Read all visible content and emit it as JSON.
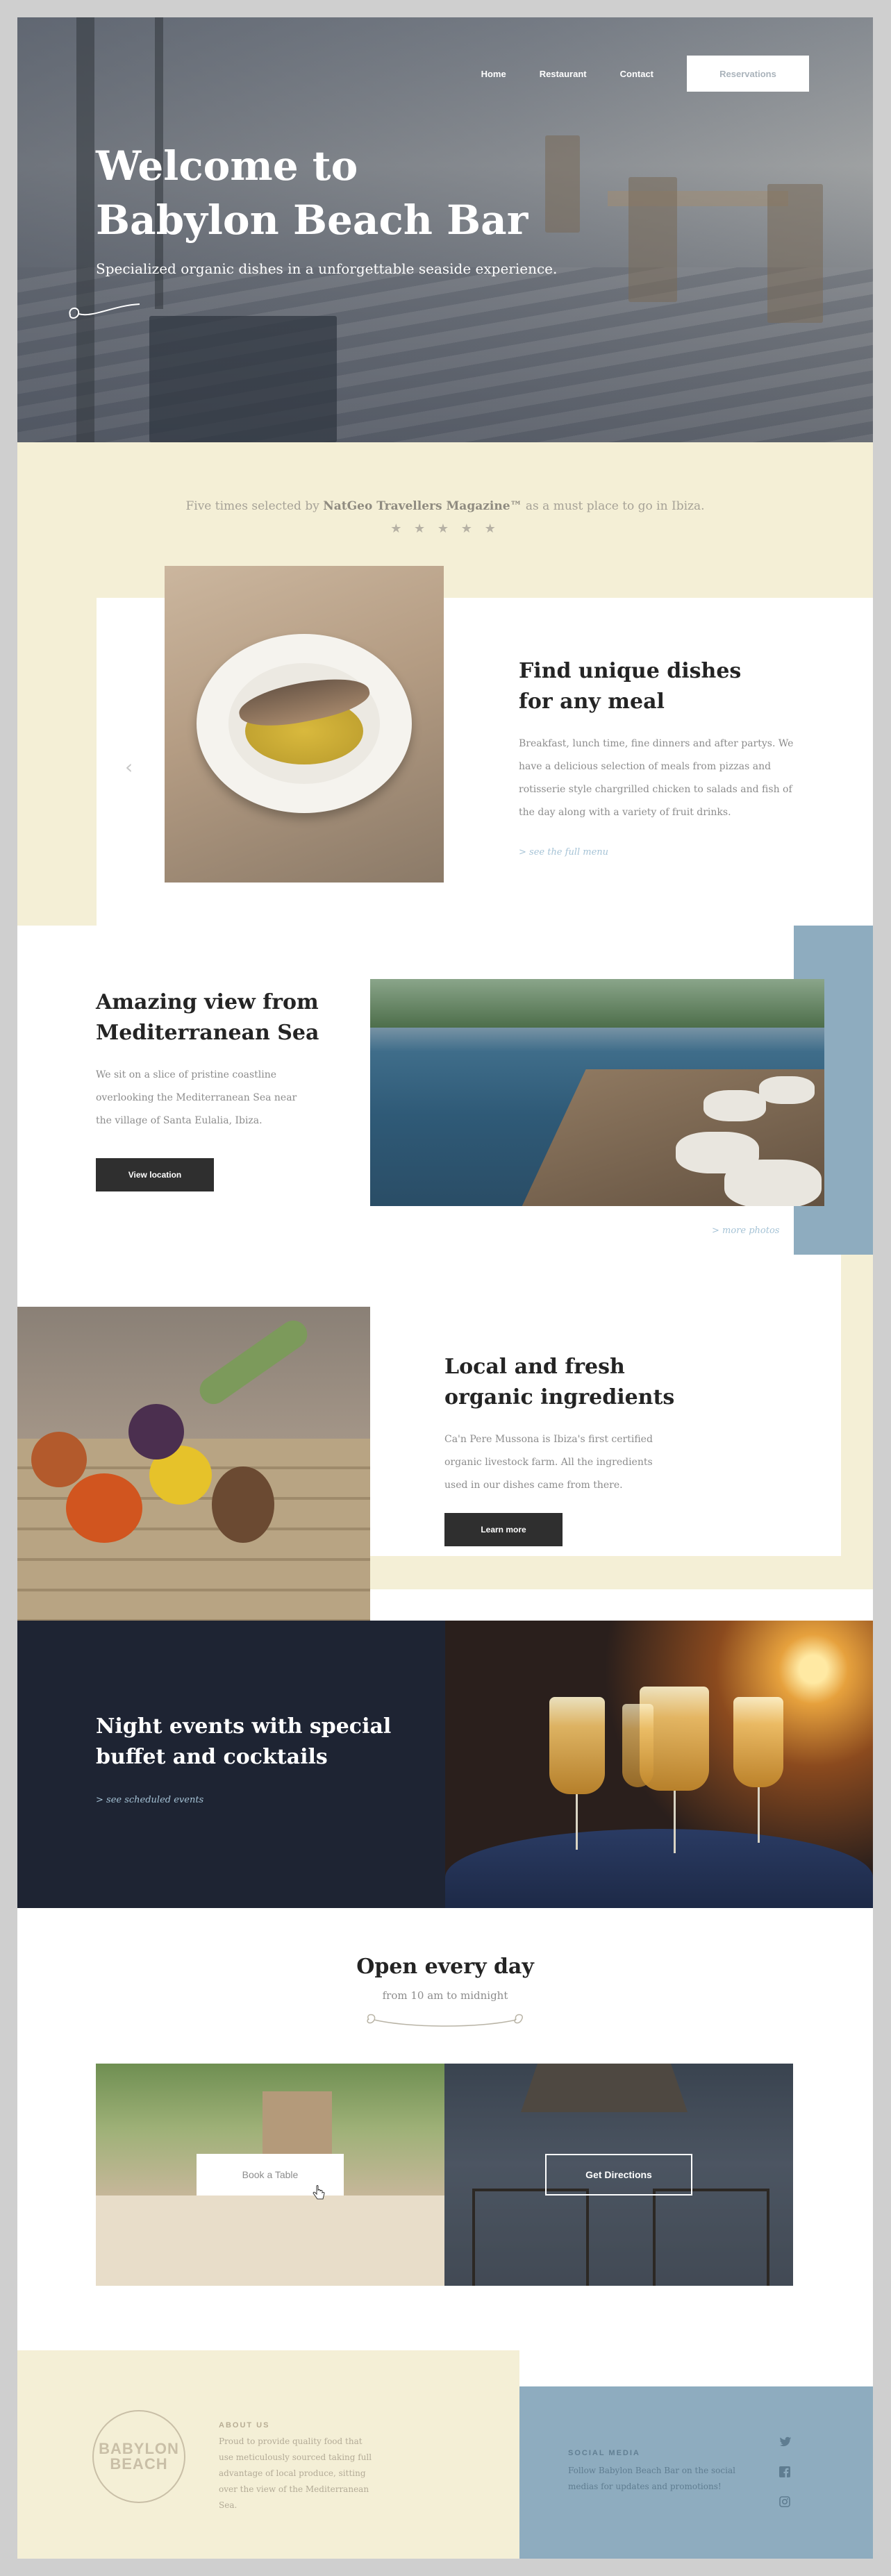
{
  "nav": {
    "home": "Home",
    "restaurant": "Restaurant",
    "contact": "Contact",
    "reservations": "Reservations"
  },
  "hero": {
    "title_line1": "Welcome to",
    "title_line2": "Babylon Beach Bar",
    "subtitle": "Specialized organic dishes in a unforgettable seaside experience."
  },
  "award": {
    "prefix": "Five times selected by",
    "magazine": "NatGeo Travellers Magazine™",
    "suffix": "as a must place to go in Ibiza.",
    "stars": "★ ★ ★ ★ ★"
  },
  "dishes": {
    "title_line1": "Find unique dishes",
    "title_line2": "for any meal",
    "text": "Breakfast, lunch time, fine dinners and after partys. We have a delicious selection of meals from pizzas and rotisserie style chargrilled chicken to salads and fish of the day along with a variety of fruit drinks.",
    "link": "> see the full menu",
    "prev": "‹"
  },
  "view": {
    "title_line1": "Amazing view from",
    "title_line2": "Mediterranean Sea",
    "text": "We sit on a slice of pristine coastline overlooking the Mediterranean Sea near the village of Santa Eulalia, Ibiza.",
    "button": "View location",
    "link": "> more photos"
  },
  "organic": {
    "title_line1": "Local and fresh",
    "title_line2": "organic ingredients",
    "text": "Ca'n Pere Mussona is Ibiza's first certified organic livestock farm. All the ingredients used in our dishes came from there.",
    "button": "Learn more"
  },
  "night": {
    "title_line1": "Night events with special",
    "title_line2": "buffet and cocktails",
    "link": "> see scheduled events"
  },
  "open": {
    "title": "Open every day",
    "subtitle": "from 10 am to midnight",
    "book_button": "Book a Table",
    "directions_button": "Get Directions"
  },
  "footer": {
    "logo_line1": "BABYLON",
    "logo_line2": "BEACH",
    "about_head": "ABOUT US",
    "about_text": "Proud to provide quality food that use meticulously sourced taking full advantage of local produce, sitting over the view of the Mediterranean Sea.",
    "social_head": "SOCIAL MEDIA",
    "social_text": "Follow Babylon Beach Bar on the social medias for updates and promotions!",
    "icons": [
      "twitter-icon",
      "facebook-icon",
      "instagram-icon"
    ]
  },
  "colors": {
    "cream": "#f4efd6",
    "steel_blue": "#8eacbf",
    "navy": "#1e2433",
    "dark_button": "#2f2f2f",
    "link_blue": "#a6c3d6"
  }
}
